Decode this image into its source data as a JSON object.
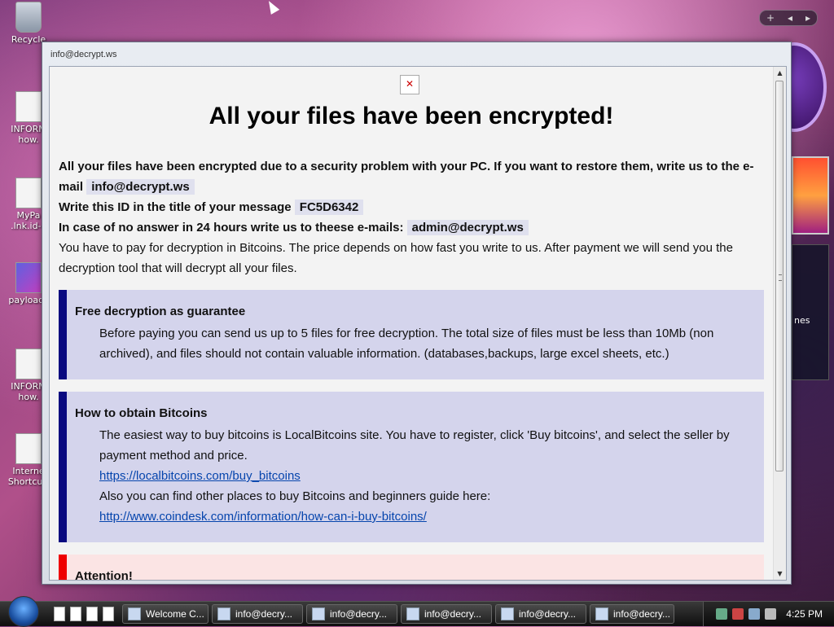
{
  "desktop": {
    "icons": [
      {
        "label": "Recycle",
        "icon": "recycle-bin-icon"
      },
      {
        "label": "INFORM\nhow.",
        "icon": "text-file-icon"
      },
      {
        "label": "MyPa\n.lnk.id-F",
        "icon": "file-icon"
      },
      {
        "label": "payload_",
        "icon": "payload-icon"
      },
      {
        "label": "INFORM\nhow.",
        "icon": "text-file-icon"
      },
      {
        "label": "Interne\nShortcut.",
        "icon": "file-icon"
      }
    ]
  },
  "sidebar": {
    "controls": [
      "+",
      "◂",
      "▸"
    ],
    "feed_label": "nes"
  },
  "window": {
    "title": "info@decrypt.ws",
    "headline": "All your files have been encrypted!",
    "intro": {
      "line1": "All your files have been encrypted due to a security problem with your PC. If you want to restore them, write us to the e-mail",
      "email": "info@decrypt.ws",
      "id_label": "Write this ID in the title of your message",
      "id_value": "FC5D6342",
      "backup_label": "In case of no answer in 24 hours write us to theese e-mails:",
      "backup_email": "admin@decrypt.ws",
      "pay_text": "You have to pay for decryption in Bitcoins. The price depends on how fast you write to us. After payment we will send you the decryption tool that will decrypt all your files."
    },
    "guarantee": {
      "heading": "Free decryption as guarantee",
      "text": "Before paying you can send us up to 5 files for free decryption. The total size of files must be less than 10Mb (non archived), and files should not contain valuable information. (databases,backups, large excel sheets, etc.)"
    },
    "bitcoins": {
      "heading": "How to obtain Bitcoins",
      "text": "The easiest way to buy bitcoins is LocalBitcoins site. You have to register, click 'Buy bitcoins', and select the seller by payment method and price.",
      "link1": "https://localbitcoins.com/buy_bitcoins",
      "text2": "Also you can find other places to buy Bitcoins and beginners guide here:",
      "link2": "http://www.coindesk.com/information/how-can-i-buy-bitcoins/"
    },
    "attention": {
      "heading": "Attention!"
    }
  },
  "taskbar": {
    "tasks": [
      {
        "label": "Welcome C..."
      },
      {
        "label": "info@decry..."
      },
      {
        "label": "info@decry..."
      },
      {
        "label": "info@decry..."
      },
      {
        "label": "info@decry..."
      },
      {
        "label": "info@decry..."
      }
    ],
    "clock": "4:25 PM"
  }
}
